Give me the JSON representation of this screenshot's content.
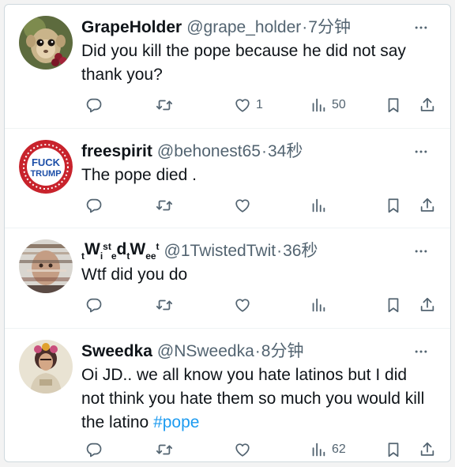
{
  "tweets": [
    {
      "display_name": "GrapeHolder",
      "handle": "@grape_holder",
      "separator": "·",
      "time": "7分钟",
      "text": "Did you kill the pope because he did not say thank you?",
      "replies": "",
      "retweets": "",
      "likes": "1",
      "views": "50",
      "avatar_icon": "monkey-holding-grapes-avatar"
    },
    {
      "display_name": "freespirit",
      "handle": "@behonest65",
      "separator": "·",
      "time": "34秒",
      "text": "The pope died .",
      "likes": "",
      "views": "",
      "avatar_logo_text": [
        "FUCK",
        "TRUMP"
      ],
      "avatar_icon": "protest-badge-avatar"
    },
    {
      "display_name_parts": [
        "t",
        "W",
        "i",
        "st",
        "e",
        "d",
        "t",
        "W",
        "ee",
        "t"
      ],
      "handle": "@1TwistedTwit",
      "separator": "·",
      "time": "36秒",
      "text": "Wtf did you do",
      "likes": "",
      "views": "",
      "avatar_icon": "glitch-portrait-avatar"
    },
    {
      "display_name": "Sweedka",
      "handle": "@NSweedka",
      "separator": "·",
      "time": "8分钟",
      "text": "Oi JD.. we all know you hate latinos but I did not think you hate them so much you would kill the latino ",
      "hashtag": "#pope",
      "likes": "",
      "views": "62",
      "avatar_icon": "illustrated-woman-avatar"
    }
  ],
  "colors": {
    "text": "#0f1419",
    "muted": "#536471",
    "link": "#1d9bf0",
    "divider": "#eff3f4"
  },
  "icons": [
    "reply-icon",
    "retweet-icon",
    "like-icon",
    "views-icon",
    "bookmark-icon",
    "share-icon",
    "more-icon"
  ]
}
